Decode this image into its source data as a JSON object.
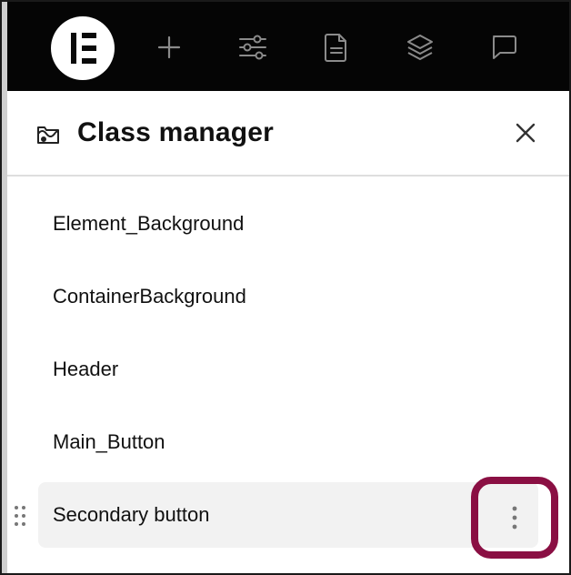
{
  "app": {
    "toolbar": {
      "logo_icon": "elementor-logo",
      "buttons": [
        {
          "name": "add-icon"
        },
        {
          "name": "settings-sliders-icon"
        },
        {
          "name": "page-document-icon"
        },
        {
          "name": "layers-icon"
        },
        {
          "name": "comments-icon"
        }
      ]
    }
  },
  "panel": {
    "title": "Class manager",
    "header_icon": "class-manager-icon",
    "close_icon": "close-icon",
    "items": [
      {
        "label": "Element_Background",
        "selected": false
      },
      {
        "label": "ContainerBackground",
        "selected": false
      },
      {
        "label": "Header",
        "selected": false
      },
      {
        "label": "Main_Button",
        "selected": false
      },
      {
        "label": "Secondary button",
        "selected": true
      }
    ],
    "selected_item_actions_icon": "more-vertical-icon"
  },
  "colors": {
    "topbar_background": "#050505",
    "selected_row_background": "#f2f2f2",
    "highlight_ring": "#8a0f43"
  }
}
